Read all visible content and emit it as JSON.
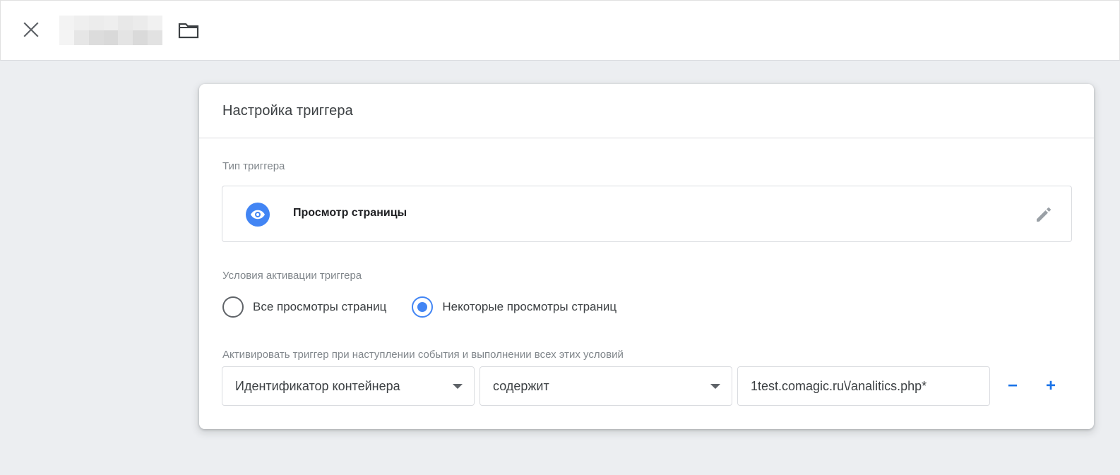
{
  "colors": {
    "accent": "#4285f4",
    "link_blue": "#1a73e8",
    "icon_gray": "#5f6368",
    "background": "#eceef1"
  },
  "topbar": {
    "close_icon": "close-icon",
    "folder_icon": "folder-icon"
  },
  "card": {
    "title": "Настройка триггера",
    "trigger_type_label": "Тип триггера",
    "trigger_type": {
      "name": "Просмотр страницы",
      "icon": "eye-icon",
      "edit_icon": "pencil-icon"
    },
    "activation_label": "Условия активации триггера",
    "activation_options": [
      {
        "label": "Все просмотры страниц",
        "selected": false
      },
      {
        "label": "Некоторые просмотры страниц",
        "selected": true
      }
    ],
    "conditions_label": "Активировать триггер при наступлении события и выполнении всех этих условий",
    "condition": {
      "variable": "Идентификатор контейнера",
      "operator": "содержит",
      "value": "1test.comagic.ru\\/analitics.php*",
      "remove_label": "−",
      "add_label": "+"
    }
  }
}
